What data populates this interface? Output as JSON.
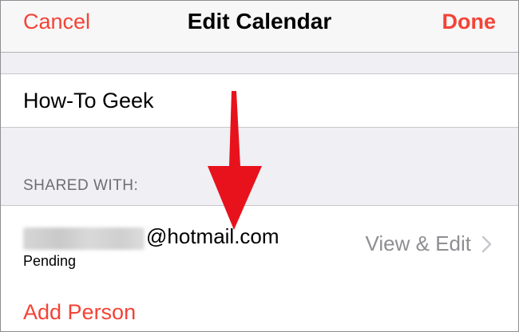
{
  "navbar": {
    "cancel_label": "Cancel",
    "title": "Edit Calendar",
    "done_label": "Done"
  },
  "calendar": {
    "name": "How-To Geek"
  },
  "shared_section": {
    "header": "SHARED WITH:",
    "person": {
      "email_domain": "@hotmail.com",
      "status": "Pending",
      "permission": "View & Edit"
    },
    "add_label": "Add Person"
  },
  "colors": {
    "accent": "#f44336",
    "annotation_arrow": "#e8121c",
    "secondary_text": "#8e8e93",
    "background": "#efeff4"
  },
  "icons": [
    "chevron-right-icon",
    "red-arrow-annotation"
  ]
}
